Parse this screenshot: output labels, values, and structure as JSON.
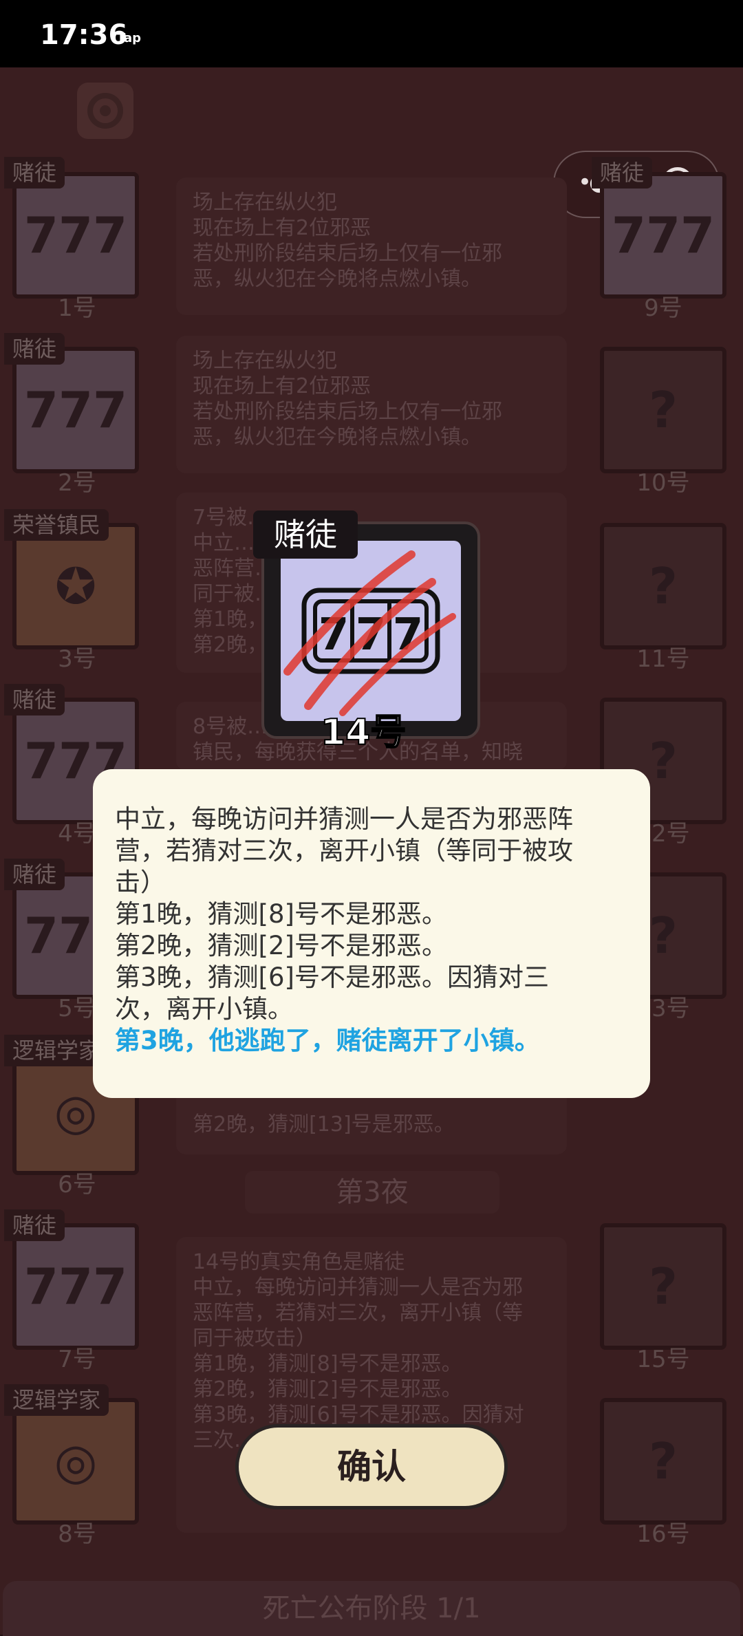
{
  "status_bar": {
    "time": "17:36",
    "app_badge": "Tap"
  },
  "left_roles": [
    {
      "tag": "赌徒",
      "num": "1号"
    },
    {
      "tag": "赌徒",
      "num": "2号"
    },
    {
      "tag": "荣誉镇民",
      "num": "3号"
    },
    {
      "tag": "赌徒",
      "num": "4号"
    },
    {
      "tag": "赌徒",
      "num": "5号"
    },
    {
      "tag": "逻辑学家",
      "num": "6号"
    },
    {
      "tag": "赌徒",
      "num": "7号"
    },
    {
      "tag": "逻辑学家",
      "num": "8号"
    }
  ],
  "right_roles": [
    {
      "tag": "赌徒",
      "num": "9号"
    },
    {
      "tag": "",
      "num": "10号"
    },
    {
      "tag": "",
      "num": "11号"
    },
    {
      "tag": "",
      "num": "12号"
    },
    {
      "tag": "",
      "num": "13号"
    },
    {
      "tag": "",
      "num": "15号"
    },
    {
      "tag": "",
      "num": "16号"
    }
  ],
  "panels": {
    "p1": [
      "场上存在纵火犯",
      "现在场上有2位邪恶",
      "若处刑阶段结束后场上仅有一位邪",
      "恶，纵火犯在今晚将点燃小镇。"
    ],
    "p2": [
      "场上存在纵火犯",
      "现在场上有2位邪恶",
      "若处刑阶段结束后场上仅有一位邪",
      "恶，纵火犯在今晚将点燃小镇。"
    ],
    "p3": [
      "7号被…",
      "中立…",
      "恶阵营…",
      "同于被…",
      "第1晚，…",
      "第2晚，…"
    ],
    "p4": [
      "8号被…",
      "镇民，每晚获得三个人的名单，知晓"
    ],
    "p6": [
      "第2晚，猜测[13]号是邪恶。"
    ],
    "p7": [
      "14号的真实角色是赌徒",
      "中立，每晚访问并猜测一人是否为邪",
      "恶阵营，若猜对三次，离开小镇（等",
      "同于被攻击）",
      "第1晚，猜测[8]号不是邪恶。",
      "第2晚，猜测[2]号不是邪恶。",
      "第3晚，猜测[6]号不是邪恶。因猜对",
      "三次…"
    ]
  },
  "night_banner": "第3夜",
  "phase_bar": "死亡公布阶段 1/1",
  "featured": {
    "role": "赌徒",
    "number": "14号",
    "icon": "slot-777-icon"
  },
  "dialog": {
    "lines": [
      "中立，每晚访问并猜测一人是否为邪恶阵",
      "营，若猜对三次，离开小镇（等同于被攻",
      "击）",
      "第1晚，猜测[8]号不是邪恶。",
      "第2晚，猜测[2]号不是邪恶。",
      "第3晚，猜测[6]号不是邪恶。因猜对三",
      "次，离开小镇。"
    ],
    "result": "第3晚，他逃跑了，赌徒离开了小镇。",
    "result_color": "#1fa3e1"
  },
  "confirm_label": "确认"
}
